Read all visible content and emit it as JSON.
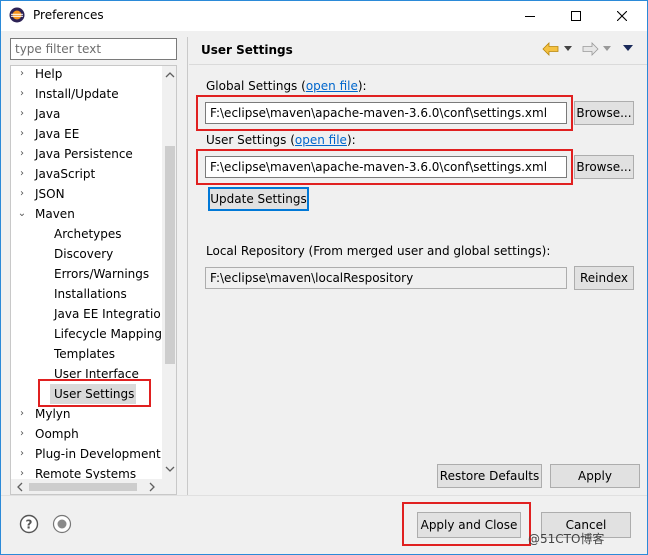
{
  "window": {
    "title": "Preferences"
  },
  "filter": {
    "placeholder": "type filter text"
  },
  "tree": {
    "items": [
      {
        "label": "Help",
        "expanded": false
      },
      {
        "label": "Install/Update",
        "expanded": false
      },
      {
        "label": "Java",
        "expanded": false
      },
      {
        "label": "Java EE",
        "expanded": false
      },
      {
        "label": "Java Persistence",
        "expanded": false
      },
      {
        "label": "JavaScript",
        "expanded": false
      },
      {
        "label": "JSON",
        "expanded": false
      },
      {
        "label": "Maven",
        "expanded": true
      },
      {
        "label": "Archetypes"
      },
      {
        "label": "Discovery"
      },
      {
        "label": "Errors/Warnings"
      },
      {
        "label": "Installations"
      },
      {
        "label": "Java EE Integratio"
      },
      {
        "label": "Lifecycle Mapping"
      },
      {
        "label": "Templates"
      },
      {
        "label": "User Interface"
      },
      {
        "label": "User Settings",
        "selected": true
      },
      {
        "label": "Mylyn",
        "expanded": false
      },
      {
        "label": "Oomph",
        "expanded": false
      },
      {
        "label": "Plug-in Development",
        "expanded": false
      },
      {
        "label": "Remote Systems",
        "expanded": false
      }
    ]
  },
  "page": {
    "title": "User Settings",
    "global_settings_label": "Global Settings (",
    "open_file": "open file",
    "label_close": "):",
    "global_settings_value": "F:\\eclipse\\maven\\apache-maven-3.6.0\\conf\\settings.xml",
    "user_settings_label": "User Settings (",
    "user_settings_value": "F:\\eclipse\\maven\\apache-maven-3.6.0\\conf\\settings.xml",
    "browse_label": "Browse...",
    "update_settings_label": "Update Settings",
    "local_repo_label": "Local Repository (From merged user and global settings):",
    "local_repo_value": "F:\\eclipse\\maven\\localRespository",
    "reindex_label": "Reindex",
    "restore_defaults_label": "Restore Defaults",
    "apply_label": "Apply"
  },
  "footer": {
    "apply_close_label": "Apply and Close",
    "cancel_label": "Cancel",
    "watermark": "@51CTO博客"
  },
  "colors": {
    "highlight": "#e02020",
    "link": "#0066cc",
    "selection": "#d9d9d9",
    "title_border": "#2b8ad8"
  }
}
